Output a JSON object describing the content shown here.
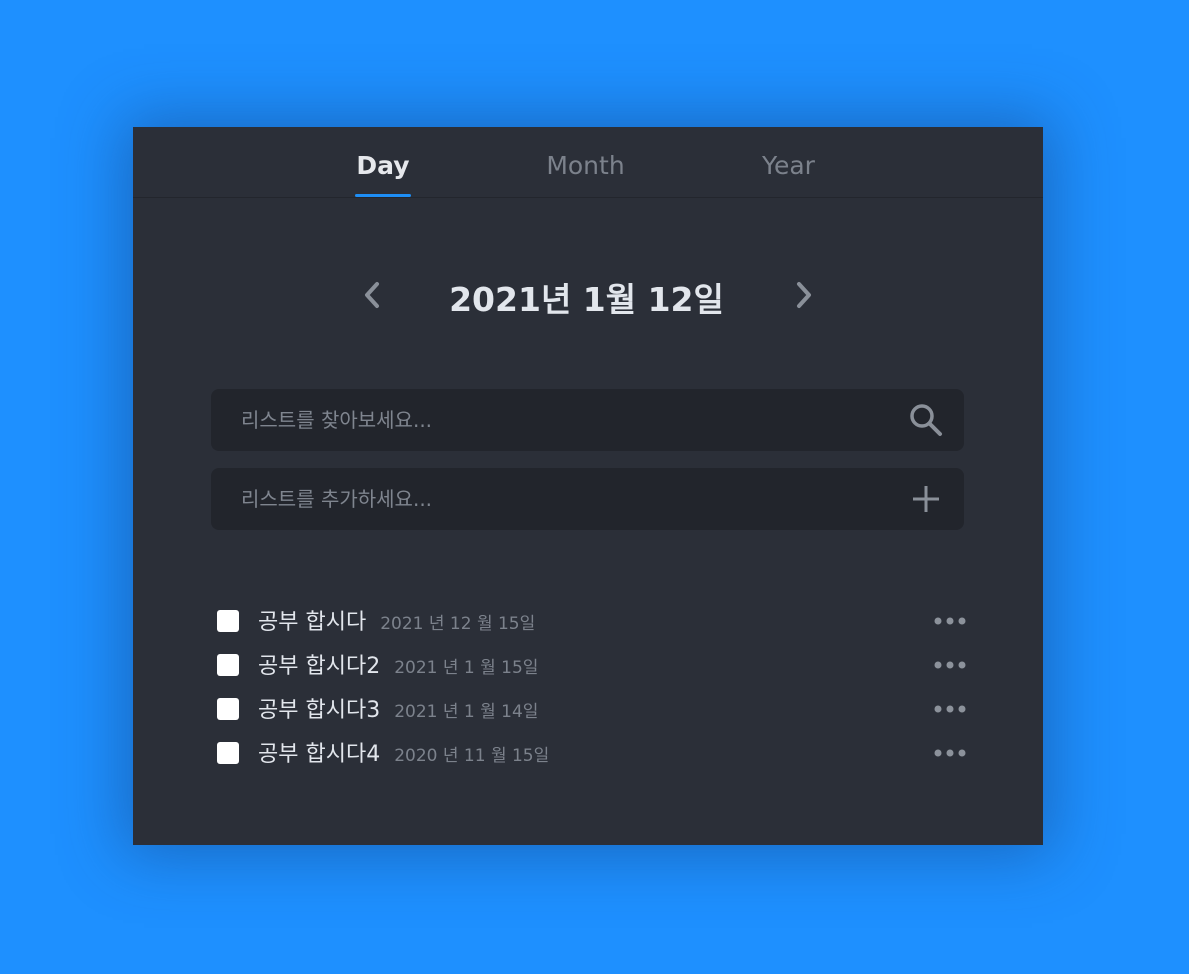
{
  "tabs": [
    {
      "label": "Day",
      "active": true
    },
    {
      "label": "Month",
      "active": false
    },
    {
      "label": "Year",
      "active": false
    }
  ],
  "date_nav": {
    "title": "2021년 1월 12일",
    "prev_icon": "chevron-left-icon",
    "next_icon": "chevron-right-icon"
  },
  "search": {
    "placeholder": "리스트를 찾아보세요...",
    "value": "",
    "icon": "search-icon"
  },
  "add": {
    "placeholder": "리스트를 추가하세요...",
    "value": "",
    "icon": "plus-icon"
  },
  "todos": [
    {
      "title": "공부 합시다",
      "date": "2021 년 12 월 15일",
      "checked": false
    },
    {
      "title": "공부 합시다2",
      "date": "2021 년 1 월 15일",
      "checked": false
    },
    {
      "title": "공부 합시다3",
      "date": "2021 년 1 월 14일",
      "checked": false
    },
    {
      "title": "공부 합시다4",
      "date": "2020 년 11 월 15일",
      "checked": false
    }
  ],
  "colors": {
    "background": "#1e90ff",
    "card": "#2b2f38",
    "field": "#22252c",
    "accent": "#1e8ef5",
    "text_primary": "#e2e6ec",
    "text_muted": "#7c828c"
  }
}
